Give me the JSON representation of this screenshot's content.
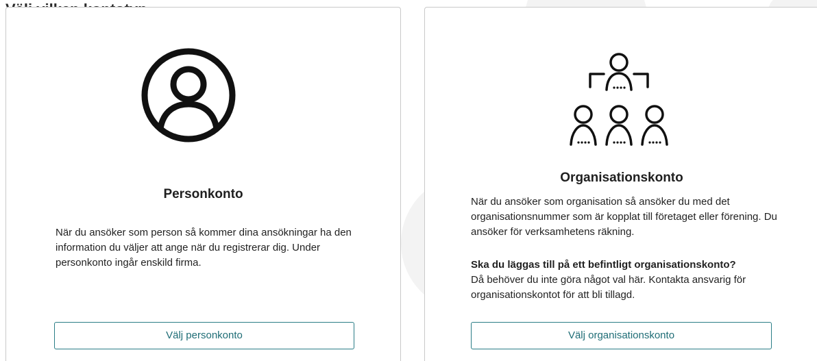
{
  "page": {
    "heading": "Välj vilken kontotyp"
  },
  "cards": {
    "person": {
      "icon": "user-circle-icon",
      "title": "Personkonto",
      "description": "När du ansöker som person så kommer dina ansökningar ha den information du väljer att ange när du registrerar dig. Under personkonto ingår enskild firma.",
      "button_label": "Välj personkonto"
    },
    "organisation": {
      "icon": "organisation-group-icon",
      "title": "Organisationskonto",
      "description": "När du ansöker som organisation så ansöker du med det organisationsnummer som är kopplat till företaget eller förening. Du ansöker för verksamhetens räkning.",
      "existing_heading": "Ska du läggas till på ett befintligt organisationskonto?",
      "existing_text": "Då behöver du inte göra något val här. Kontakta ansvarig för organisationskontot för att bli tillagd.",
      "button_label": "Välj organisationskonto"
    }
  },
  "colors": {
    "button_border": "#2a7d86",
    "button_text": "#1f6d76",
    "card_border": "#c9c9c9"
  }
}
